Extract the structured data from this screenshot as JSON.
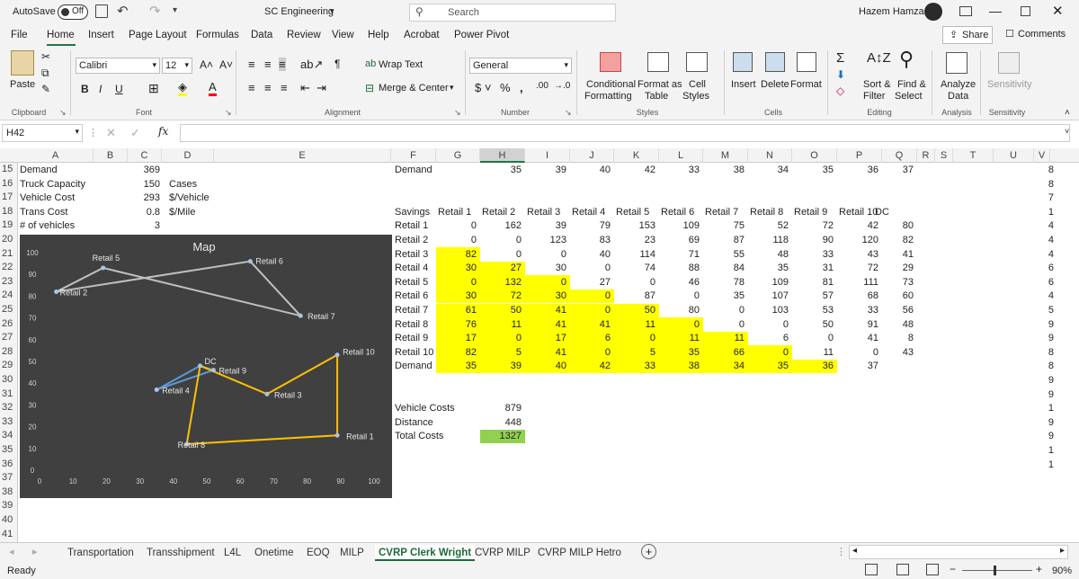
{
  "titlebar": {
    "autosave_label": "AutoSave",
    "autosave_state": "Off",
    "doc_title": "SC Engineering",
    "search_placeholder": "Search",
    "user_name": "Hazem Hamza"
  },
  "menu": {
    "items": [
      "File",
      "Home",
      "Insert",
      "Page Layout",
      "Formulas",
      "Data",
      "Review",
      "View",
      "Help",
      "Acrobat",
      "Power Pivot"
    ],
    "share": "Share",
    "comments": "Comments"
  },
  "ribbon": {
    "paste": "Paste",
    "font_name": "Calibri",
    "font_size": "12",
    "wrap_text": "Wrap Text",
    "merge_center": "Merge & Center",
    "number_format": "General",
    "cond_fmt_1": "Conditional",
    "cond_fmt_2": "Formatting",
    "format_table_1": "Format as",
    "format_table_2": "Table",
    "cell_styles_1": "Cell",
    "cell_styles_2": "Styles",
    "insert": "Insert",
    "delete": "Delete",
    "format": "Format",
    "sort_filter_1": "Sort &",
    "sort_filter_2": "Filter",
    "find_select_1": "Find &",
    "find_select_2": "Select",
    "analyze_1": "Analyze",
    "analyze_2": "Data",
    "sensitivity": "Sensitivity",
    "groups": {
      "clipboard": "Clipboard",
      "font": "Font",
      "alignment": "Alignment",
      "number": "Number",
      "styles": "Styles",
      "cells": "Cells",
      "editing": "Editing",
      "analysis": "Analysis",
      "sensitivity": "Sensitivity"
    }
  },
  "formula_bar": {
    "name_box": "H42",
    "fx": "fx",
    "formula": ""
  },
  "columns": [
    "A",
    "B",
    "C",
    "D",
    "E",
    "F",
    "G",
    "H",
    "I",
    "J",
    "K",
    "L",
    "M",
    "N",
    "O",
    "P",
    "Q",
    "R",
    "S",
    "T",
    "U",
    "V"
  ],
  "rows": [
    "15",
    "16",
    "17",
    "18",
    "19",
    "20",
    "21",
    "22",
    "23",
    "24",
    "25",
    "26",
    "27",
    "28",
    "29",
    "30",
    "31",
    "32",
    "33",
    "34",
    "35",
    "36",
    "37",
    "38",
    "39",
    "40",
    "41"
  ],
  "params": [
    {
      "label": "Demand",
      "value": "369",
      "unit": ""
    },
    {
      "label": "Truck Capacity",
      "value": "150",
      "unit": "Cases"
    },
    {
      "label": "Vehicle Cost",
      "value": "293",
      "unit": "$/Vehicle"
    },
    {
      "label": "Trans Cost",
      "value": "0.8",
      "unit": "$/Mile"
    },
    {
      "label": "# of vehicles",
      "value": "3",
      "unit": ""
    }
  ],
  "demand_row": {
    "label": "Demand",
    "values": [
      "35",
      "39",
      "40",
      "42",
      "33",
      "38",
      "34",
      "35",
      "36",
      "37"
    ]
  },
  "savings": {
    "corner": "Savings",
    "headers": [
      "Retail 1",
      "Retail 2",
      "Retail 3",
      "Retail 4",
      "Retail 5",
      "Retail 6",
      "Retail 7",
      "Retail 8",
      "Retail 9",
      "Retail 10",
      "DC"
    ],
    "rows": [
      {
        "label": "Retail 1",
        "values": [
          "",
          "0",
          "162",
          "39",
          "79",
          "153",
          "109",
          "75",
          "52",
          "72",
          "42",
          "80"
        ]
      },
      {
        "label": "Retail 2",
        "values": [
          "",
          "0",
          "0",
          "123",
          "83",
          "23",
          "69",
          "87",
          "118",
          "90",
          "120",
          "82"
        ]
      },
      {
        "label": "Retail 3",
        "values": [
          "",
          "82",
          "0",
          "0",
          "40",
          "114",
          "71",
          "55",
          "48",
          "33",
          "43",
          "41"
        ]
      },
      {
        "label": "Retail 4",
        "values": [
          "",
          "30",
          "27",
          "30",
          "0",
          "74",
          "88",
          "84",
          "35",
          "31",
          "72",
          "29"
        ]
      },
      {
        "label": "Retail 5",
        "values": [
          "",
          "0",
          "132",
          "0",
          "27",
          "0",
          "46",
          "78",
          "109",
          "81",
          "111",
          "73"
        ]
      },
      {
        "label": "Retail 6",
        "values": [
          "",
          "30",
          "72",
          "30",
          "0",
          "87",
          "0",
          "35",
          "107",
          "57",
          "68",
          "60"
        ]
      },
      {
        "label": "Retail 7",
        "values": [
          "",
          "61",
          "50",
          "41",
          "0",
          "50",
          "80",
          "0",
          "103",
          "53",
          "33",
          "56"
        ]
      },
      {
        "label": "Retail 8",
        "values": [
          "",
          "76",
          "11",
          "41",
          "41",
          "11",
          "0",
          "0",
          "0",
          "50",
          "91",
          "48"
        ]
      },
      {
        "label": "Retail 9",
        "values": [
          "",
          "17",
          "0",
          "17",
          "6",
          "0",
          "11",
          "11",
          "6",
          "0",
          "41",
          "8"
        ]
      },
      {
        "label": "Retail 10",
        "values": [
          "",
          "82",
          "5",
          "41",
          "0",
          "5",
          "35",
          "66",
          "0",
          "11",
          "0",
          "43"
        ]
      }
    ],
    "demand_label": "Demand",
    "demand_values": [
      "35",
      "39",
      "40",
      "42",
      "33",
      "38",
      "34",
      "35",
      "36",
      "37"
    ]
  },
  "extra_col_values": [
    "8",
    "8",
    "7",
    "1",
    "4",
    "4",
    "4",
    "6",
    "6",
    "4",
    "5",
    "9",
    "9",
    "8",
    "8",
    "9",
    "9",
    "1",
    "9",
    "9",
    "1",
    "1"
  ],
  "costs": [
    {
      "label": "Vehicle Costs",
      "value": "879"
    },
    {
      "label": "Distance",
      "value": "448"
    },
    {
      "label": "Total Costs",
      "value": "1327"
    }
  ],
  "chart_data": {
    "type": "scatter",
    "title": "Map",
    "xlim": [
      0,
      100
    ],
    "ylim": [
      0,
      100
    ],
    "xticks": [
      "0",
      "10",
      "20",
      "30",
      "40",
      "50",
      "60",
      "70",
      "80",
      "90",
      "100"
    ],
    "yticks": [
      "0",
      "10",
      "20",
      "30",
      "40",
      "50",
      "60",
      "70",
      "80",
      "90",
      "100"
    ],
    "points": [
      {
        "name": "Retail 1",
        "x": 89,
        "y": 16
      },
      {
        "name": "Retail 2",
        "x": 5,
        "y": 82
      },
      {
        "name": "Retail 3",
        "x": 68,
        "y": 35
      },
      {
        "name": "Retail 4",
        "x": 35,
        "y": 37
      },
      {
        "name": "Retail 5",
        "x": 19,
        "y": 93
      },
      {
        "name": "Retail 6",
        "x": 63,
        "y": 96
      },
      {
        "name": "Retail 7",
        "x": 78,
        "y": 71
      },
      {
        "name": "Retail 8",
        "x": 44,
        "y": 12
      },
      {
        "name": "Retail 9",
        "x": 52,
        "y": 46
      },
      {
        "name": "Retail 10",
        "x": 89,
        "y": 53
      },
      {
        "name": "DC",
        "x": 48,
        "y": 48
      }
    ],
    "routes": [
      {
        "color": "#c0c0c0",
        "path": [
          "Retail 2",
          "Retail 5",
          "Retail 7",
          "Retail 6",
          "Retail 2"
        ]
      },
      {
        "color": "#5b9bd5",
        "path": [
          "DC",
          "Retail 4",
          "Retail 9",
          "DC"
        ]
      },
      {
        "color": "#ffc000",
        "path": [
          "DC",
          "Retail 3",
          "Retail 10",
          "Retail 1",
          "Retail 8",
          "DC"
        ]
      }
    ]
  },
  "sheet_tabs": [
    "Transportation",
    "Transshipment",
    "L4L",
    "Onetime",
    "EOQ",
    "MILP",
    "CVRP Clerk Wright",
    "CVRP MILP",
    "CVRP MILP Hetro"
  ],
  "active_tab": "CVRP Clerk Wright",
  "status": {
    "ready": "Ready",
    "zoom": "90%"
  }
}
